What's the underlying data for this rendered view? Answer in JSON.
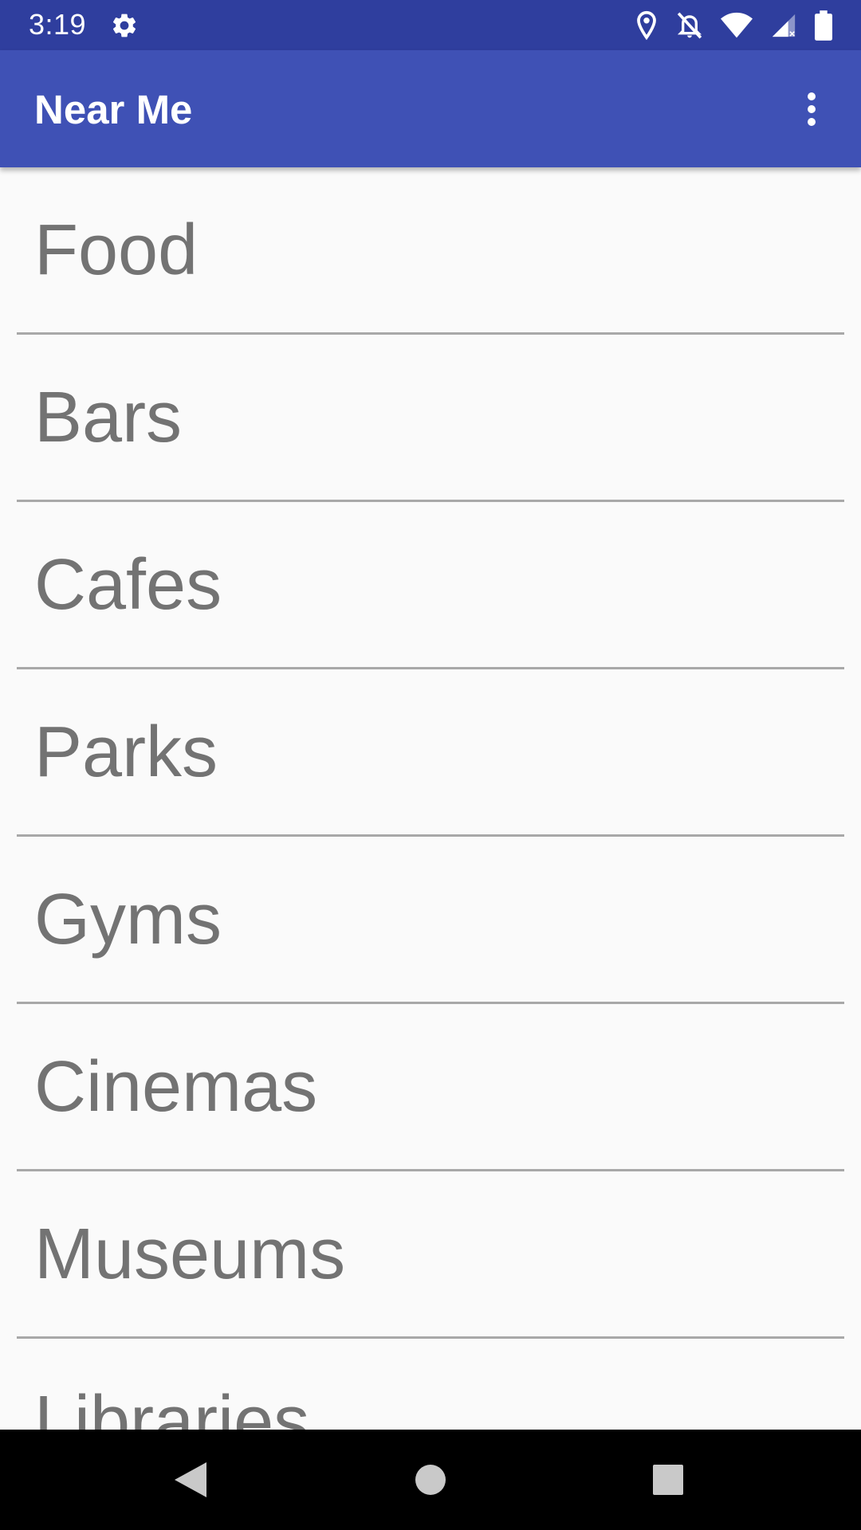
{
  "status_bar": {
    "time": "3:19",
    "icons": [
      "gear-icon",
      "location-icon",
      "notifications-off-icon",
      "wifi-icon",
      "signal-icon",
      "battery-icon"
    ],
    "background": "#2f3e9e"
  },
  "app_bar": {
    "title": "Near Me",
    "overflow_icon": "more-vert-icon",
    "background": "#3f51b5"
  },
  "list": {
    "items": [
      {
        "label": "Food"
      },
      {
        "label": "Bars"
      },
      {
        "label": "Cafes"
      },
      {
        "label": "Parks"
      },
      {
        "label": "Gyms"
      },
      {
        "label": "Cinemas"
      },
      {
        "label": "Museums"
      },
      {
        "label": "Libraries"
      }
    ],
    "text_color": "#737373",
    "divider_color": "#a8a8a8"
  },
  "nav_bar": {
    "icons": [
      "back-icon",
      "home-icon",
      "recents-icon"
    ]
  }
}
